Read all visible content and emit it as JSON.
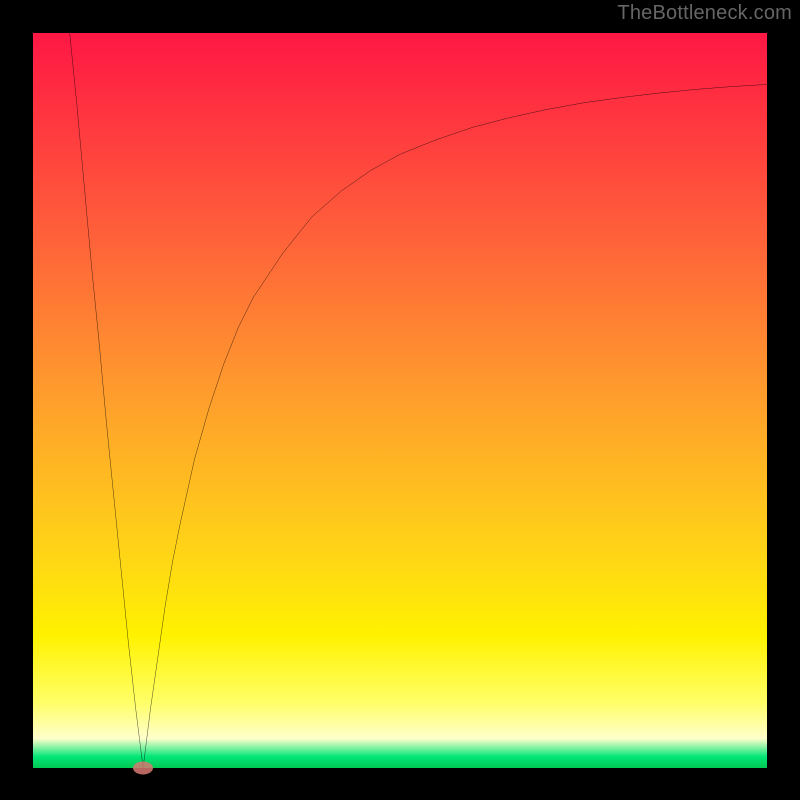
{
  "watermark": "TheBottleneck.com",
  "chart_data": {
    "type": "line",
    "title": "",
    "xlabel": "",
    "ylabel": "",
    "x_range": [
      0,
      100
    ],
    "y_range": [
      0,
      100
    ],
    "series": [
      {
        "name": "curve",
        "color": "#000000",
        "points": [
          [
            5,
            100
          ],
          [
            6,
            90
          ],
          [
            7,
            79
          ],
          [
            8,
            68
          ],
          [
            9,
            58
          ],
          [
            10,
            47
          ],
          [
            11,
            37
          ],
          [
            12,
            27
          ],
          [
            13,
            17
          ],
          [
            14,
            8
          ],
          [
            15,
            0
          ],
          [
            16,
            8
          ],
          [
            17,
            15
          ],
          [
            18,
            22
          ],
          [
            19,
            28
          ],
          [
            20,
            33
          ],
          [
            22,
            42
          ],
          [
            24,
            49
          ],
          [
            26,
            55
          ],
          [
            28,
            60
          ],
          [
            30,
            64
          ],
          [
            34,
            70
          ],
          [
            38,
            75
          ],
          [
            42,
            78.5
          ],
          [
            46,
            81.3
          ],
          [
            50,
            83.5
          ],
          [
            55,
            85.5
          ],
          [
            60,
            87.2
          ],
          [
            65,
            88.5
          ],
          [
            70,
            89.6
          ],
          [
            75,
            90.5
          ],
          [
            80,
            91.2
          ],
          [
            85,
            91.8
          ],
          [
            90,
            92.3
          ],
          [
            95,
            92.7
          ],
          [
            100,
            93
          ]
        ]
      }
    ],
    "marker": {
      "x": 15,
      "y": 0,
      "color": "#d77871"
    },
    "gradient_stops": [
      {
        "offset": 0,
        "color": "#ff1744"
      },
      {
        "offset": 0.27,
        "color": "#ff5f3a"
      },
      {
        "offset": 0.5,
        "color": "#ff9f2c"
      },
      {
        "offset": 0.72,
        "color": "#ffd815"
      },
      {
        "offset": 0.82,
        "color": "#fff200"
      },
      {
        "offset": 0.91,
        "color": "#ffff66"
      },
      {
        "offset": 0.96,
        "color": "#ffffcc"
      },
      {
        "offset": 0.985,
        "color": "#00e676"
      },
      {
        "offset": 1.0,
        "color": "#00c853"
      }
    ]
  }
}
